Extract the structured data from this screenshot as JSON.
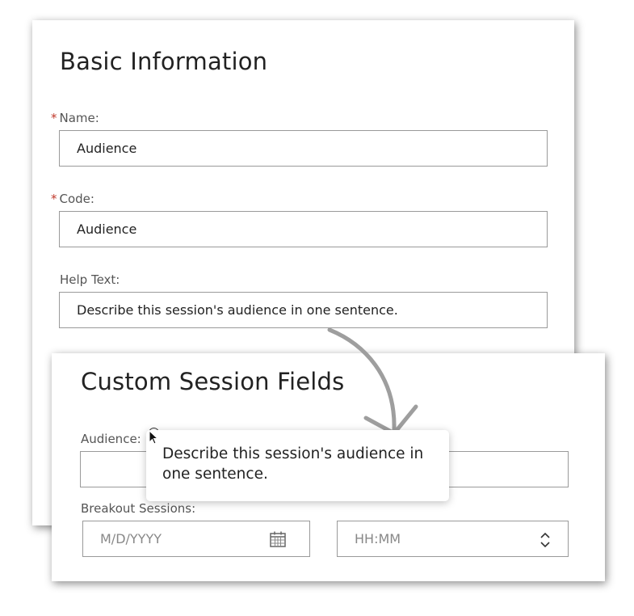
{
  "basic_info": {
    "title": "Basic Information",
    "name_field": {
      "required_mark": "*",
      "label": "Name:",
      "value": "Audience"
    },
    "code_field": {
      "required_mark": "*",
      "label": "Code:",
      "value": "Audience"
    },
    "help_text_field": {
      "label": "Help Text:",
      "value": "Describe this session's audience in one sentence."
    }
  },
  "custom_fields": {
    "title": "Custom Session Fields",
    "audience_label": "Audience:",
    "audience_value": "",
    "breakout_label": "Breakout Sessions:",
    "date_placeholder": "M/D/YYYY",
    "time_placeholder": "HH:MM"
  },
  "tooltip": {
    "text": "Describe this session's audience in one sentence."
  },
  "icons": {
    "calendar": "calendar-icon",
    "time_stepper": "chevron-up-down-icon",
    "info": "info-icon",
    "cursor": "mouse-pointer-icon",
    "arrow": "curved-arrow-icon"
  },
  "colors": {
    "required": "#c0392b",
    "border": "#9a9a9a",
    "arrow": "#9e9e9e"
  }
}
